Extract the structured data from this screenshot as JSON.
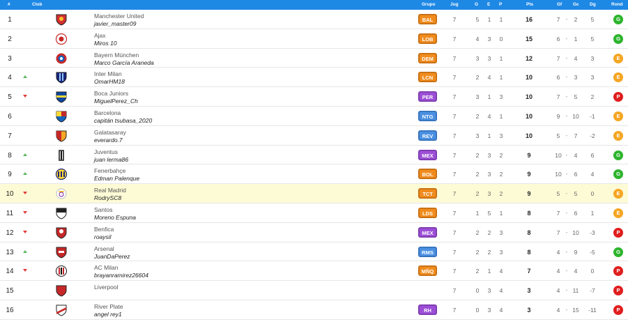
{
  "header": {
    "pos": "#",
    "club": "Club",
    "group": "Grupo",
    "played": "Jug",
    "won": "G",
    "drawn": "E",
    "lost": "P",
    "points": "Pts",
    "gf": "Gf",
    "gc": "Gc",
    "dg": "Dg",
    "rond": "Rond"
  },
  "colors": {
    "header_bg": "#1e88e5",
    "group_orange": "#f08c1e",
    "group_purple": "#9c4fd6",
    "group_blue": "#4a90e2",
    "rond_G": "#2db52d",
    "rond_E": "#f5a623",
    "rond_P": "#e01e1e",
    "highlight": "#fdfbd6"
  },
  "rows": [
    {
      "pos": "1",
      "trend": "none",
      "club": "Manchester United",
      "manager": "javier_master09",
      "group": "BAL",
      "group_color": "orange",
      "played": "7",
      "won": "5",
      "drawn": "1",
      "lost": "1",
      "pts": "16",
      "gf": "7",
      "gc": "2",
      "dg": "5",
      "rond": "G",
      "crest": "crest-manutd-icon",
      "highlight": false
    },
    {
      "pos": "2",
      "trend": "none",
      "club": "Ajax",
      "manager": "Miros 10",
      "group": "LOB",
      "group_color": "orange",
      "played": "7",
      "won": "4",
      "drawn": "3",
      "lost": "0",
      "pts": "15",
      "gf": "6",
      "gc": "1",
      "dg": "5",
      "rond": "G",
      "crest": "crest-ajax-icon",
      "highlight": false
    },
    {
      "pos": "3",
      "trend": "none",
      "club": "Bayern München",
      "manager": "Marco García Araneda",
      "group": "DEM",
      "group_color": "orange",
      "played": "7",
      "won": "3",
      "drawn": "3",
      "lost": "1",
      "pts": "12",
      "gf": "7",
      "gc": "4",
      "dg": "3",
      "rond": "E",
      "crest": "crest-bayern-icon",
      "highlight": false
    },
    {
      "pos": "4",
      "trend": "up",
      "club": "Inter Milan",
      "manager": "OmarHM18",
      "group": "LCN",
      "group_color": "orange",
      "played": "7",
      "won": "2",
      "drawn": "4",
      "lost": "1",
      "pts": "10",
      "gf": "6",
      "gc": "3",
      "dg": "3",
      "rond": "E",
      "crest": "crest-inter-icon",
      "highlight": false
    },
    {
      "pos": "5",
      "trend": "down",
      "club": "Boca Juniors",
      "manager": "MiguelPerez_Ch",
      "group": "PER",
      "group_color": "purple",
      "played": "7",
      "won": "3",
      "drawn": "1",
      "lost": "3",
      "pts": "10",
      "gf": "7",
      "gc": "5",
      "dg": "2",
      "rond": "P",
      "crest": "crest-boca-icon",
      "highlight": false
    },
    {
      "pos": "6",
      "trend": "none",
      "club": "Barcelona",
      "manager": "capitán tsubasa_2020",
      "group": "NTG",
      "group_color": "blue",
      "played": "7",
      "won": "2",
      "drawn": "4",
      "lost": "1",
      "pts": "10",
      "gf": "9",
      "gc": "10",
      "dg": "-1",
      "rond": "E",
      "crest": "crest-barcelona-icon",
      "highlight": false
    },
    {
      "pos": "7",
      "trend": "none",
      "club": "Galatasaray",
      "manager": "everardo.7",
      "group": "REV",
      "group_color": "blue",
      "played": "7",
      "won": "3",
      "drawn": "1",
      "lost": "3",
      "pts": "10",
      "gf": "5",
      "gc": "7",
      "dg": "-2",
      "rond": "E",
      "crest": "crest-galatasaray-icon",
      "highlight": false
    },
    {
      "pos": "8",
      "trend": "up",
      "club": "Juventus",
      "manager": "juan lerma86",
      "group": "MEX",
      "group_color": "purple",
      "played": "7",
      "won": "2",
      "drawn": "3",
      "lost": "2",
      "pts": "9",
      "gf": "10",
      "gc": "4",
      "dg": "6",
      "rond": "G",
      "crest": "crest-juventus-icon",
      "highlight": false
    },
    {
      "pos": "9",
      "trend": "up",
      "club": "Fenerbahçe",
      "manager": "Edman Palenque",
      "group": "BOL",
      "group_color": "orange",
      "played": "7",
      "won": "2",
      "drawn": "3",
      "lost": "2",
      "pts": "9",
      "gf": "10",
      "gc": "6",
      "dg": "4",
      "rond": "G",
      "crest": "crest-fenerbahce-icon",
      "highlight": false
    },
    {
      "pos": "10",
      "trend": "down",
      "club": "Real Madrid",
      "manager": "RodrySC8",
      "group": "TCT",
      "group_color": "orange",
      "played": "7",
      "won": "2",
      "drawn": "3",
      "lost": "2",
      "pts": "9",
      "gf": "5",
      "gc": "5",
      "dg": "0",
      "rond": "E",
      "crest": "crest-realmadrid-icon",
      "highlight": true
    },
    {
      "pos": "11",
      "trend": "down",
      "club": "Santos",
      "manager": "Moreno Espuna",
      "group": "LDS",
      "group_color": "orange",
      "played": "7",
      "won": "1",
      "drawn": "5",
      "lost": "1",
      "pts": "8",
      "gf": "7",
      "gc": "6",
      "dg": "1",
      "rond": "E",
      "crest": "crest-santos-icon",
      "highlight": false
    },
    {
      "pos": "12",
      "trend": "down",
      "club": "Benfica",
      "manager": "roaysil",
      "group": "MEX",
      "group_color": "purple",
      "played": "7",
      "won": "2",
      "drawn": "2",
      "lost": "3",
      "pts": "8",
      "gf": "7",
      "gc": "10",
      "dg": "-3",
      "rond": "P",
      "crest": "crest-benfica-icon",
      "highlight": false
    },
    {
      "pos": "13",
      "trend": "up",
      "club": "Arsenal",
      "manager": "JuanDaPerez",
      "group": "RMS",
      "group_color": "blue",
      "played": "7",
      "won": "2",
      "drawn": "2",
      "lost": "3",
      "pts": "8",
      "gf": "4",
      "gc": "9",
      "dg": "-5",
      "rond": "G",
      "crest": "crest-arsenal-icon",
      "highlight": false
    },
    {
      "pos": "14",
      "trend": "down",
      "club": "AC Milan",
      "manager": "brayanramirez26604",
      "group": "MÑQ",
      "group_color": "orange",
      "played": "7",
      "won": "2",
      "drawn": "1",
      "lost": "4",
      "pts": "7",
      "gf": "4",
      "gc": "4",
      "dg": "0",
      "rond": "P",
      "crest": "crest-acmilan-icon",
      "highlight": false
    },
    {
      "pos": "15",
      "trend": "none",
      "club": "Liverpool",
      "manager": "",
      "group": "",
      "group_color": "none",
      "played": "7",
      "won": "0",
      "drawn": "3",
      "lost": "4",
      "pts": "3",
      "gf": "4",
      "gc": "11",
      "dg": "-7",
      "rond": "P",
      "crest": "crest-liverpool-icon",
      "highlight": false
    },
    {
      "pos": "16",
      "trend": "none",
      "club": "River Plate",
      "manager": "angel rey1",
      "group": "RH",
      "group_color": "purple",
      "played": "7",
      "won": "0",
      "drawn": "3",
      "lost": "4",
      "pts": "3",
      "gf": "4",
      "gc": "15",
      "dg": "-11",
      "rond": "P",
      "crest": "crest-riverplate-icon",
      "highlight": false
    }
  ]
}
